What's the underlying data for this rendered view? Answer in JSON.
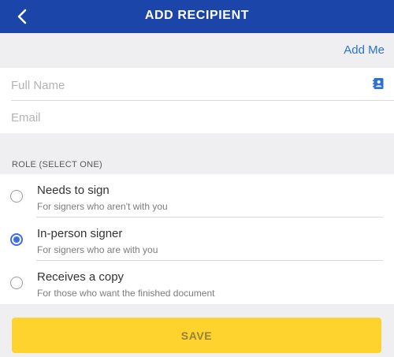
{
  "header": {
    "title": "ADD RECIPIENT",
    "back_icon": "chevron-left-icon"
  },
  "add_me": {
    "label": "Add Me"
  },
  "fields": {
    "full_name": {
      "placeholder": "Full Name",
      "value": ""
    },
    "email": {
      "placeholder": "Email",
      "value": ""
    },
    "contact_icon": "contacts-book-icon"
  },
  "role": {
    "label": "ROLE (SELECT ONE)",
    "options": [
      {
        "title": "Needs to sign",
        "desc": "For signers who aren't with you",
        "selected": false
      },
      {
        "title": "In-person signer",
        "desc": "For signers who are with you",
        "selected": true
      },
      {
        "title": "Receives a copy",
        "desc": "For those who want the finished document",
        "selected": false
      }
    ]
  },
  "save": {
    "label": "SAVE"
  },
  "colors": {
    "header": "#1b45a8",
    "accent": "#2a73d3",
    "radio_selected": "#3c6ee0",
    "save_button": "#ffd32e"
  }
}
